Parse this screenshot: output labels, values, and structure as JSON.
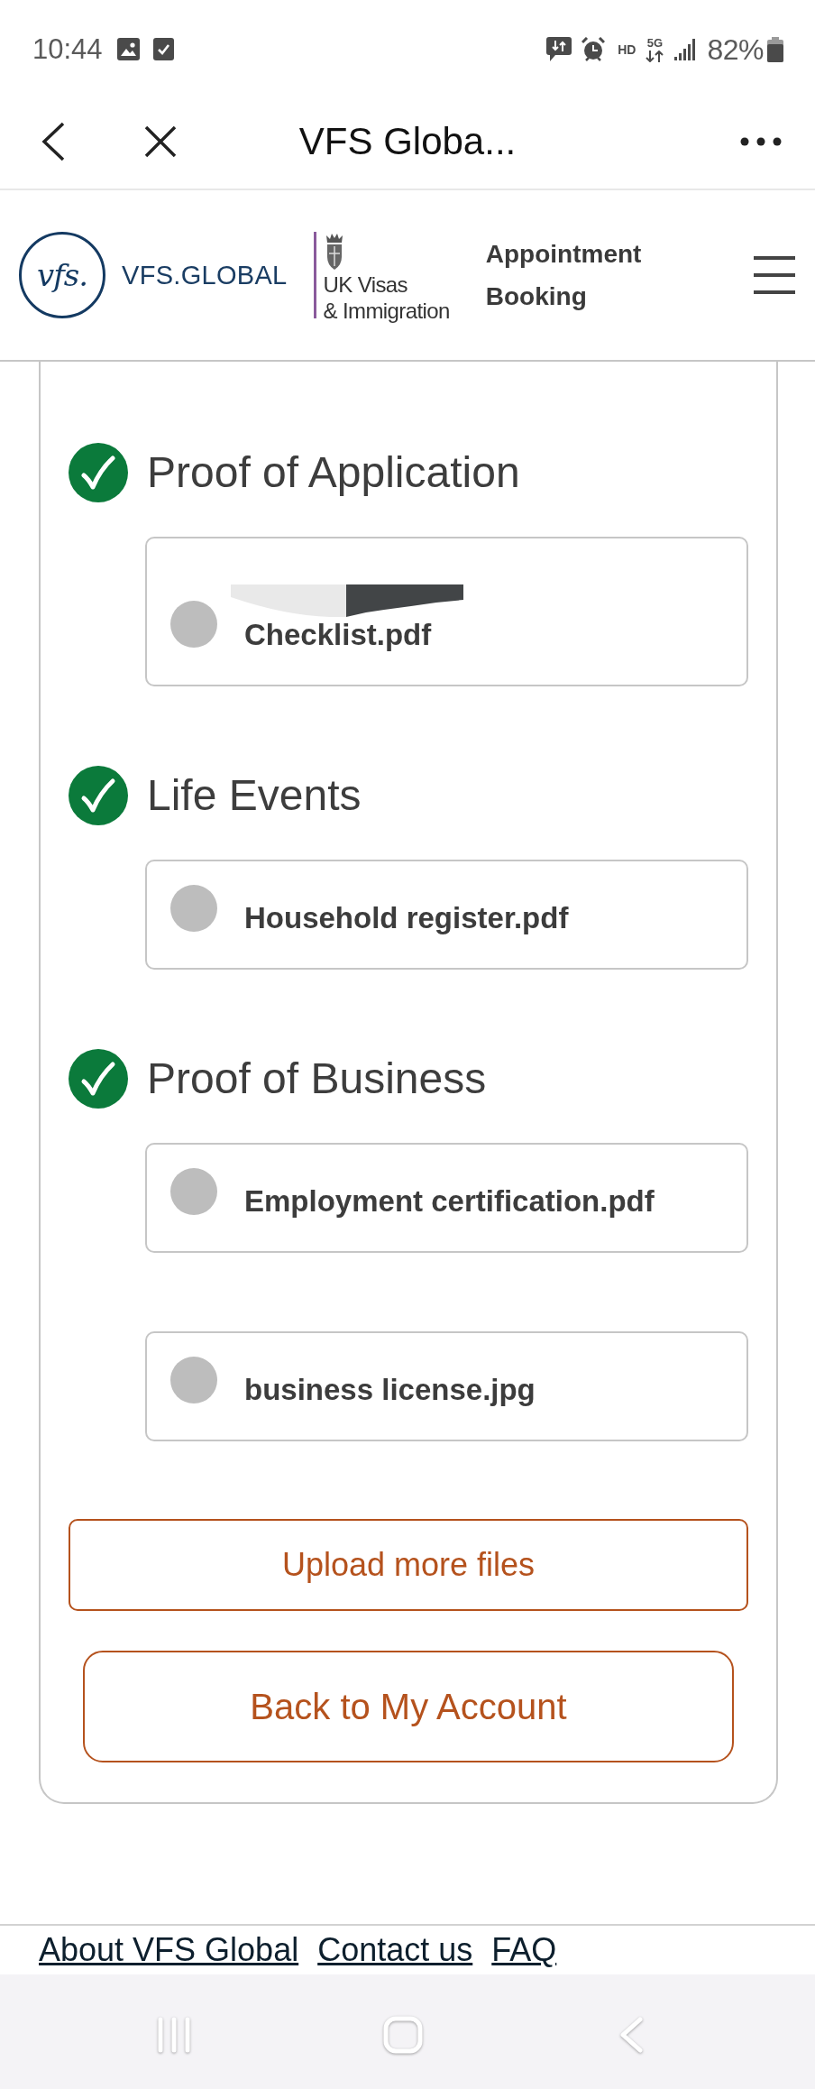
{
  "status_bar": {
    "time": "10:44",
    "hd_label": "HD",
    "network_label": "5G",
    "battery": "82%"
  },
  "browser_bar": {
    "title": "VFS Globa..."
  },
  "header": {
    "logo_mark": "vfs.",
    "brand": "VFS.GLOBAL",
    "partner_lines": [
      "UK Visas",
      "& Immigration"
    ],
    "title": "Appointment Booking"
  },
  "sections": [
    {
      "title": "Proof of Application",
      "done": true,
      "files": [
        {
          "name": "Checklist.pdf",
          "redacted": true
        }
      ]
    },
    {
      "title": "Life Events",
      "done": true,
      "files": [
        {
          "name": "Household register.pdf",
          "redacted": false
        }
      ]
    },
    {
      "title": "Proof of Business",
      "done": true,
      "files": [
        {
          "name": "Employment certification.pdf",
          "redacted": false
        },
        {
          "name": "business license.jpg",
          "redacted": false
        }
      ]
    }
  ],
  "buttons": [
    {
      "label": "Upload more files",
      "kind": "compact"
    },
    {
      "label": "Back to My Account",
      "kind": "large"
    }
  ],
  "footer": {
    "links": [
      "About VFS Global",
      "Contact us",
      "FAQ"
    ]
  }
}
